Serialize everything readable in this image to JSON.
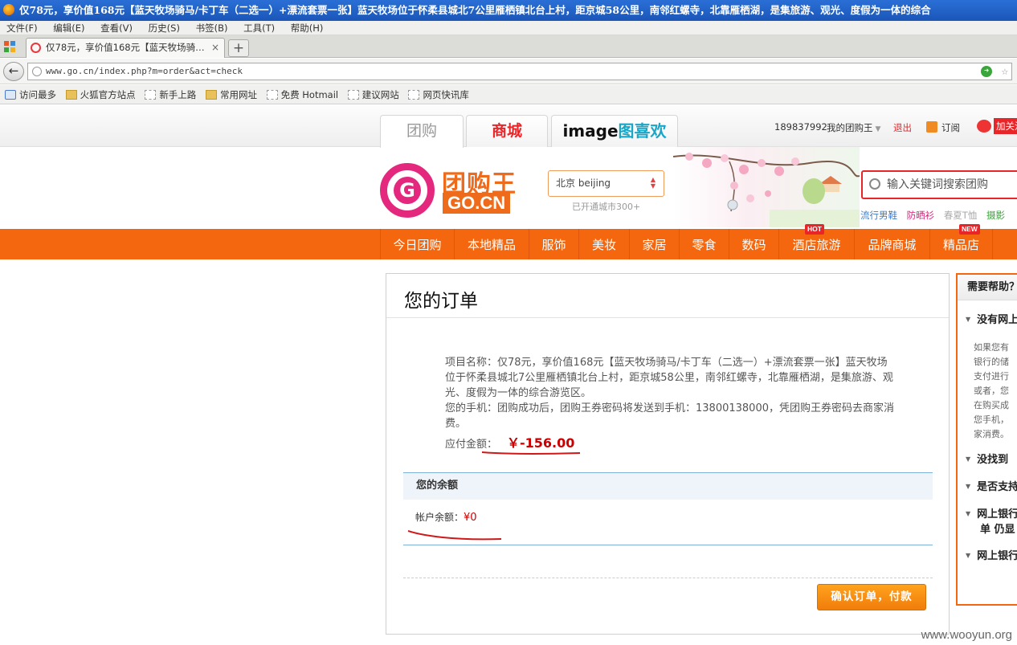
{
  "window": {
    "title": "仅78元，享价值168元【蓝天牧场骑马/卡丁车（二选一）+漂流套票一张】蓝天牧场位于怀柔县城北7公里雁栖镇北台上村，距京城58公里，南邻红螺寺，北靠雁栖湖，是集旅游、观光、度假为一体的综合"
  },
  "menu": [
    "文件(F)",
    "编辑(E)",
    "查看(V)",
    "历史(S)",
    "书签(B)",
    "工具(T)",
    "帮助(H)"
  ],
  "tab": {
    "label": "仅78元，享价值168元【蓝天牧场骑…",
    "close": "×",
    "new": "+"
  },
  "nav": {
    "back": "←",
    "url": "www.go.cn/index.php?m=order&act=check"
  },
  "bookmarks": [
    "访问最多",
    "火狐官方站点",
    "新手上路",
    "常用网址",
    "免费 Hotmail",
    "建议网站",
    "网页快讯库"
  ],
  "site": {
    "tabs": {
      "tuangou": "团购",
      "shangcheng": "商城",
      "image_en": "image",
      "image_cn": "图喜欢"
    },
    "user": {
      "phone": "189837992",
      "my": "我的团购王",
      "logout": "退出",
      "subscribe": "订阅",
      "follow": "加关注"
    },
    "logo": {
      "letter": "G",
      "name": "团购王",
      "domain": "GO.CN"
    },
    "city": {
      "current": "北京 beijing",
      "count": "已开通城市300+"
    },
    "search": {
      "placeholder": "输入关键词搜索团购"
    },
    "hotwords": [
      "流行男鞋",
      "防晒衫",
      "春夏T恤",
      "摄影"
    ],
    "colors": {
      "accent": "#f4670f",
      "brand": "#e3287d",
      "price": "#cc0000"
    }
  },
  "categories": [
    {
      "label": "今日团购"
    },
    {
      "label": "本地精品"
    },
    {
      "label": "服饰"
    },
    {
      "label": "美妆"
    },
    {
      "label": "家居"
    },
    {
      "label": "零食"
    },
    {
      "label": "数码"
    },
    {
      "label": "酒店旅游",
      "badge": "HOT"
    },
    {
      "label": "品牌商城"
    },
    {
      "label": "精品店",
      "badge": "NEW"
    }
  ],
  "order": {
    "title": "您的订单",
    "project_label": "项目名称：",
    "project_name": "仅78元，享价值168元【蓝天牧场骑马/卡丁车（二选一）+漂流套票一张】蓝天牧场位于怀柔县城北7公里雁栖镇北台上村，距京城58公里，南邻红螺寺，北靠雁栖湖，是集旅游、观光、度假为一体的综合游览区。",
    "phone_label": "您的手机：",
    "phone_text": "团购成功后，团购王券密码将发送到手机：13800138000，凭团购王券密码去商家消费。",
    "amount_label": "应付金额：",
    "amount_value": "￥-156.00",
    "balance_header": "您的余额",
    "balance_label": "帐户余额：",
    "balance_value": "¥0",
    "confirm": "确认订单，付款"
  },
  "help": {
    "title": "需要帮助？",
    "q1": "没有网上银行怎么办？",
    "body": [
      "如果您有",
      "银行的储",
      "支付进行",
      "或者，您",
      "在购买成",
      "您手机，",
      "家消费。"
    ],
    "q2": "没找到",
    "q3": "是否支持",
    "q4a": "网上银行",
    "q4b": "单 仍显",
    "q5": "网上银行"
  },
  "watermark": "www.wooyun.org"
}
